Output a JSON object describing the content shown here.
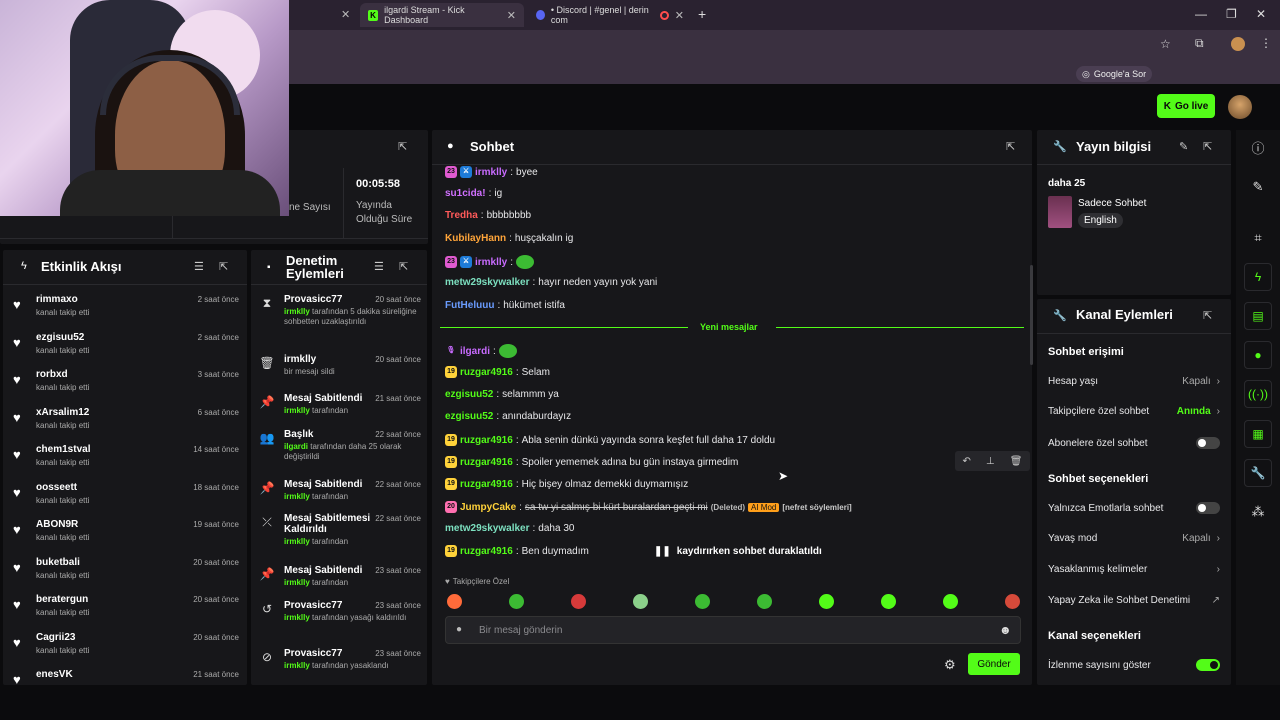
{
  "browser": {
    "tabs": [
      {
        "label": "ilgardi Stream - Kick Dashboard"
      },
      {
        "label": "• Discord | #genel | derin com"
      }
    ],
    "google_pill": "Google'a Sor"
  },
  "header": {
    "go_live": "Go live"
  },
  "stats": {
    "left_label": "ne Sayısı",
    "duration_value": "00:05:58",
    "duration_label_1": "Yayında",
    "duration_label_2": "Olduğu Süre"
  },
  "activity": {
    "title": "Etkinlik Akışı",
    "items": [
      {
        "name": "rimmaxo",
        "sub": "kanalı takip etti",
        "time": "2 saat önce"
      },
      {
        "name": "ezgisuu52",
        "sub": "kanalı takip etti",
        "time": "2 saat önce"
      },
      {
        "name": "rorbxd",
        "sub": "kanalı takip etti",
        "time": "3 saat önce"
      },
      {
        "name": "xArsalim12",
        "sub": "kanalı takip etti",
        "time": "6 saat önce"
      },
      {
        "name": "chem1stval",
        "sub": "kanalı takip etti",
        "time": "14 saat önce"
      },
      {
        "name": "oosseett",
        "sub": "kanalı takip etti",
        "time": "18 saat önce"
      },
      {
        "name": "ABON9R",
        "sub": "kanalı takip etti",
        "time": "19 saat önce"
      },
      {
        "name": "buketbali",
        "sub": "kanalı takip etti",
        "time": "20 saat önce"
      },
      {
        "name": "beratergun",
        "sub": "kanalı takip etti",
        "time": "20 saat önce"
      },
      {
        "name": "Cagrii23",
        "sub": "kanalı takip etti",
        "time": "20 saat önce"
      },
      {
        "name": "enesVK",
        "sub": "",
        "time": "21 saat önce"
      }
    ]
  },
  "modlog": {
    "title_1": "Denetim",
    "title_2": "Eylemleri",
    "items": [
      {
        "icon": "hourglass-icon",
        "glyph": "⧗",
        "name": "Provasicc77",
        "time": "20 saat önce",
        "actor": "irmklly",
        "desc": " tarafından 5 dakika süreliğine sohbetten uzaklaştırıldı"
      },
      {
        "icon": "trash-icon",
        "glyph": "🗑",
        "name": "irmklly",
        "time": "20 saat önce",
        "actor": "",
        "desc": "bir mesajı sildi"
      },
      {
        "icon": "pin-icon",
        "glyph": "📌",
        "name": "Mesaj Sabitlendi",
        "time": "21 saat önce",
        "actor": "irmklly",
        "desc": " tarafından"
      },
      {
        "icon": "users-icon",
        "glyph": "👥",
        "name": "Başlık",
        "time": "22 saat önce",
        "actor": "ilgardi",
        "desc": " tarafından daha 25 olarak değiştirildi"
      },
      {
        "icon": "pin-icon",
        "glyph": "📌",
        "name": "Mesaj Sabitlendi",
        "time": "22 saat önce",
        "actor": "irmklly",
        "desc": " tarafından"
      },
      {
        "icon": "unpin-icon",
        "glyph": "⤫",
        "name": "Mesaj Sabitlemesi Kaldırıldı",
        "time": "22 saat önce",
        "actor": "irmklly",
        "desc": " tarafından"
      },
      {
        "icon": "pin-icon",
        "glyph": "📌",
        "name": "Mesaj Sabitlendi",
        "time": "23 saat önce",
        "actor": "irmklly",
        "desc": " tarafından"
      },
      {
        "icon": "undo-icon",
        "glyph": "↺",
        "name": "Provasicc77",
        "time": "23 saat önce",
        "actor": "irmklly",
        "desc": " tarafından yasağı kaldırıldı"
      },
      {
        "icon": "ban-icon",
        "glyph": "⊘",
        "name": "Provasicc77",
        "time": "23 saat önce",
        "actor": "irmklly",
        "desc": " tarafından yasaklandı"
      }
    ]
  },
  "chat": {
    "title": "Sohbet",
    "new_messages": "Yeni mesajlar",
    "paused": "kaydırırken sohbet duraklatıldı",
    "followers_only": "Takipçilere Özel",
    "input_placeholder": "Bir mesaj gönderin",
    "send": "Gönder",
    "messages": [
      {
        "user": "irmklly",
        "color": "#c86bff",
        "text": "byee",
        "badges": [
          "23",
          "mod"
        ]
      },
      {
        "user": "su1cida!",
        "color": "#d070ff",
        "text": "ig",
        "badges": []
      },
      {
        "user": "Tredha",
        "color": "#ff5a5a",
        "text": "bbbbbbbb",
        "badges": []
      },
      {
        "user": "KubilayHann",
        "color": "#ffa53a",
        "text": "huşçakalın ig",
        "badges": []
      },
      {
        "user": "irmklly",
        "color": "#c86bff",
        "text": "",
        "badges": [
          "23",
          "mod"
        ],
        "emote": true
      },
      {
        "user": "metw29skywalker",
        "color": "#7de0c0",
        "text": "hayır neden yayın yok yani",
        "badges": []
      },
      {
        "user": "FutHeluuu",
        "color": "#6a9cff",
        "text": "hükümet istifa",
        "badges": []
      },
      {
        "user": "ilgardi",
        "color": "#c86bff",
        "text": "",
        "badges": [
          "mic"
        ],
        "emote": true
      },
      {
        "user": "ruzgar4916",
        "color": "#53fc18",
        "text": "Selam",
        "badges": [
          "19"
        ]
      },
      {
        "user": "ezgisuu52",
        "color": "#53fc18",
        "text": "selammm ya",
        "badges": []
      },
      {
        "user": "ezgisuu52",
        "color": "#53fc18",
        "text": "anındaburdayız",
        "badges": []
      },
      {
        "user": "ruzgar4916",
        "color": "#53fc18",
        "text": "Abla senin dünkü yayında sonra keşfet full daha 17 doldu",
        "badges": [
          "19"
        ]
      },
      {
        "user": "ruzgar4916",
        "color": "#53fc18",
        "text": "Spoiler yememek adına bu gün instaya girmedim",
        "badges": [
          "19"
        ]
      },
      {
        "user": "ruzgar4916",
        "color": "#53fc18",
        "text": "Hiç bişey olmaz demekki duymamışız",
        "badges": [
          "19"
        ]
      },
      {
        "user": "JumpyCake",
        "color": "#ffd23a",
        "text": "sa tw yi salmış bi kürt buralardan geçti mi",
        "badges": [
          "20"
        ],
        "deleted": "(Deleted)",
        "ai": "AI Mod",
        "reason": "[nefret söylemleri]"
      },
      {
        "user": "metw29skywalker",
        "color": "#7de0c0",
        "text": "daha 30",
        "badges": []
      },
      {
        "user": "ruzgar4916",
        "color": "#53fc18",
        "text": "Ben duymadım",
        "badges": [
          "19"
        ]
      }
    ]
  },
  "info": {
    "title": "Yayın bilgisi",
    "stream_title": "daha 25",
    "category": "Sadece Sohbet",
    "language": "English"
  },
  "actions": {
    "title": "Kanal Eylemleri",
    "sec1": "Sohbet erişimi",
    "account_age": {
      "label": "Hesap yaşı",
      "value": "Kapalı"
    },
    "followers_chat": {
      "label": "Takipçilere özel sohbet",
      "value": "Anında"
    },
    "subs_chat": {
      "label": "Abonelere özel sohbet"
    },
    "sec2": "Sohbet seçenekleri",
    "emote_only": {
      "label": "Yalnızca Emotlarla sohbet"
    },
    "slow_mode": {
      "label": "Yavaş mod",
      "value": "Kapalı"
    },
    "banned_words": {
      "label": "Yasaklanmış kelimeler"
    },
    "ai_mod": {
      "label": "Yapay Zeka ile Sohbet Denetimi"
    },
    "sec3": "Kanal seçenekleri",
    "show_views": {
      "label": "İzlenme sayısını göster"
    }
  },
  "colors": {
    "accent": "#53fc18",
    "panel": "#17171a",
    "bg": "#0b0b0d"
  }
}
